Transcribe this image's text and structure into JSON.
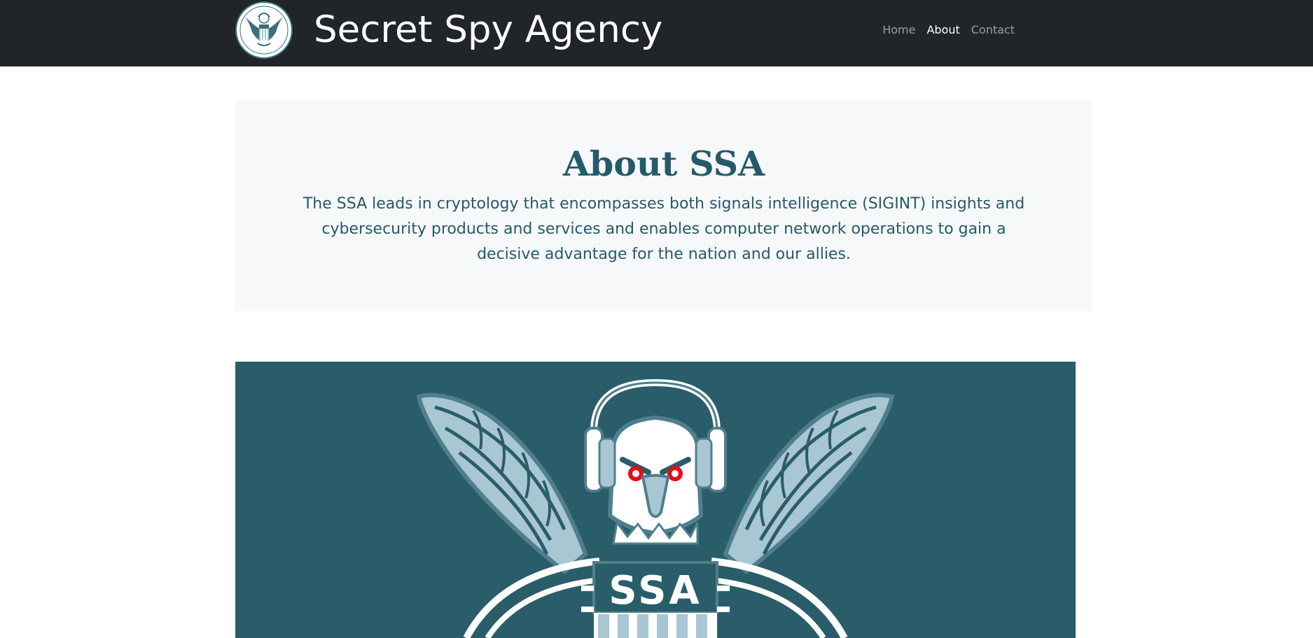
{
  "header": {
    "title": "Secret Spy Agency",
    "nav": [
      {
        "label": "Home",
        "active": false
      },
      {
        "label": "About",
        "active": true
      },
      {
        "label": "Contact",
        "active": false
      }
    ]
  },
  "about": {
    "heading": "About SSA",
    "body": "The SSA leads in cryptology that encompasses both signals intelligence (SIGINT) insights and cybersecurity products and services and enables computer network operations to gain a decisive advantage for the nation and our allies."
  },
  "emblem": {
    "text": "SSA"
  },
  "colors": {
    "navbar": "#212529",
    "accent": "#245a6a",
    "hero_background": "#295d69",
    "feather_light": "#a9c6d3",
    "eye_red": "#e0101a"
  },
  "icons": {
    "logo": "eagle-seal-icon",
    "emblem": "eagle-headphones-emblem"
  }
}
